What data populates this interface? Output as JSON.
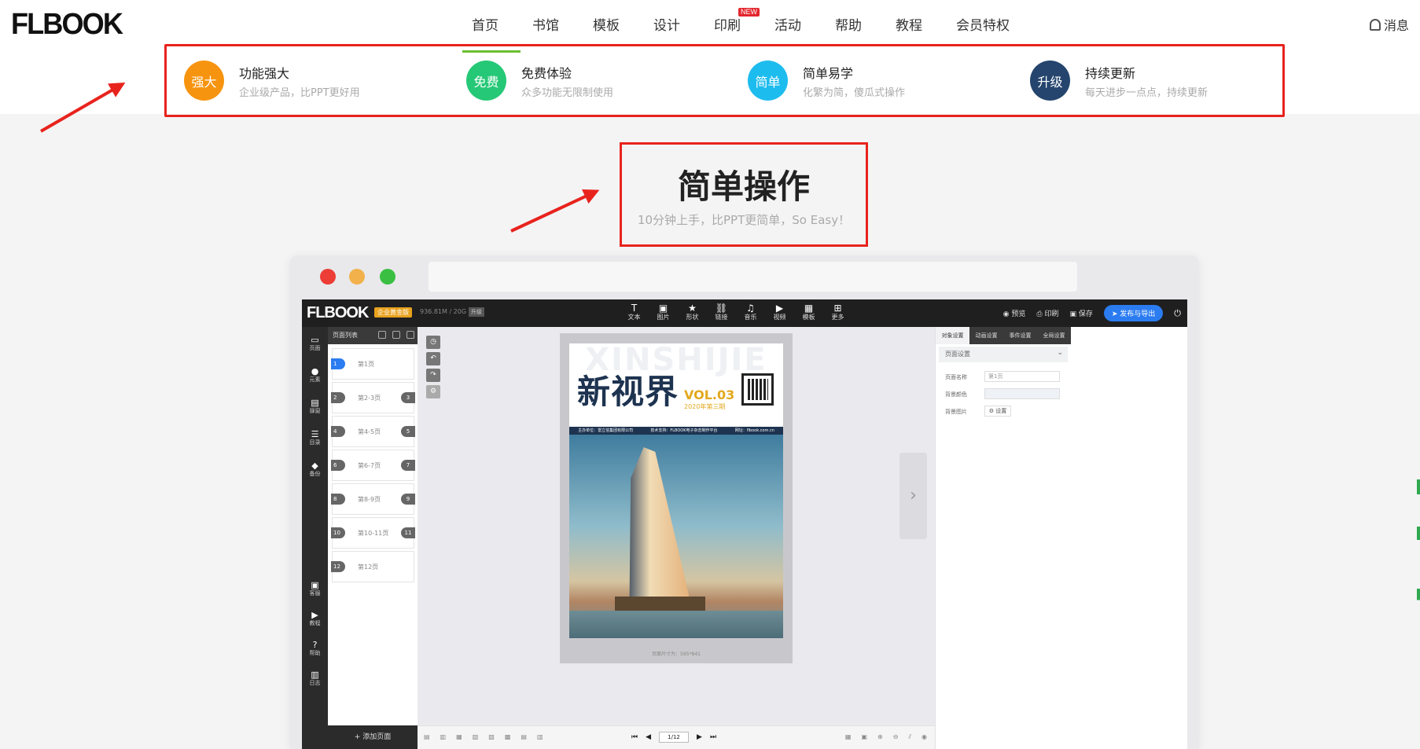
{
  "header": {
    "logo": "FLBOOK",
    "nav": [
      "首页",
      "书馆",
      "模板",
      "设计",
      "印刷",
      "活动",
      "帮助",
      "教程",
      "会员特权"
    ],
    "new_badge": "NEW",
    "messages": "消息"
  },
  "features": [
    {
      "badge": "强大",
      "title": "功能强大",
      "sub": "企业级产品，比PPT更好用",
      "color": "#f7940f"
    },
    {
      "badge": "免费",
      "title": "免费体验",
      "sub": "众多功能无限制使用",
      "color": "#25c876"
    },
    {
      "badge": "简单",
      "title": "简单易学",
      "sub": "化繁为简，傻瓜式操作",
      "color": "#1dbcee"
    },
    {
      "badge": "升级",
      "title": "持续更新",
      "sub": "每天进步一点点，持续更新",
      "color": "#25456e"
    }
  ],
  "hero": {
    "title": "简单操作",
    "subtitle": "10分钟上手，比PPT更简单，So Easy！"
  },
  "editor": {
    "logo": "FLBOOK",
    "edition": "企业黄金版",
    "storage": "936.81M / 20G",
    "upgrade": "升级",
    "tools": [
      {
        "icon": "T",
        "label": "文本"
      },
      {
        "icon": "▣",
        "label": "图片"
      },
      {
        "icon": "★",
        "label": "形状"
      },
      {
        "icon": "⛓",
        "label": "链接"
      },
      {
        "icon": "♫",
        "label": "音乐"
      },
      {
        "icon": "▶",
        "label": "视频"
      },
      {
        "icon": "▦",
        "label": "模板"
      },
      {
        "icon": "⊞",
        "label": "更多"
      }
    ],
    "right": {
      "preview": "预览",
      "print": "印刷",
      "save": "保存",
      "publish": "发布与导出"
    },
    "left_side": [
      {
        "icon": "▭",
        "label": "页面"
      },
      {
        "icon": "●",
        "label": "元素"
      },
      {
        "icon": "▤",
        "label": "弹窗"
      },
      {
        "icon": "☰",
        "label": "目录"
      },
      {
        "icon": "◆",
        "label": "备份"
      },
      {
        "icon": "▣",
        "label": "客服"
      },
      {
        "icon": "▶",
        "label": "教程"
      },
      {
        "icon": "?",
        "label": "帮助"
      },
      {
        "icon": "▥",
        "label": "日志"
      }
    ],
    "page_list": {
      "title": "页面列表",
      "pages": [
        {
          "left": "1",
          "label": "第1页",
          "right": ""
        },
        {
          "left": "2",
          "label": "第2-3页",
          "right": "3"
        },
        {
          "left": "4",
          "label": "第4-5页",
          "right": "5"
        },
        {
          "left": "6",
          "label": "第6-7页",
          "right": "7"
        },
        {
          "left": "8",
          "label": "第8-9页",
          "right": "9"
        },
        {
          "left": "10",
          "label": "第10-11页",
          "right": "11"
        },
        {
          "left": "12",
          "label": "第12页",
          "right": ""
        }
      ],
      "add_page": "+ 添加页面"
    },
    "cover": {
      "watermark": "XINSHIJIE",
      "title": "新视界",
      "vol": "VOL.03",
      "year": "2020年第三期",
      "strip": [
        "主办单位：雷立信集团有限公司",
        "技术支持：FLBOOK电子杂志制作平台",
        "网址：flbook.com.cn"
      ],
      "size": "页面尺寸为：595*841"
    },
    "panel": {
      "tabs": [
        "对象设置",
        "动画设置",
        "事件设置",
        "全局设置"
      ],
      "section": "页面设置",
      "fields": [
        {
          "label": "页面名称",
          "value": "第1页"
        },
        {
          "label": "背景颜色",
          "value": ""
        },
        {
          "label": "背景图片",
          "value": "设置"
        }
      ]
    },
    "pagination": "1/12"
  }
}
